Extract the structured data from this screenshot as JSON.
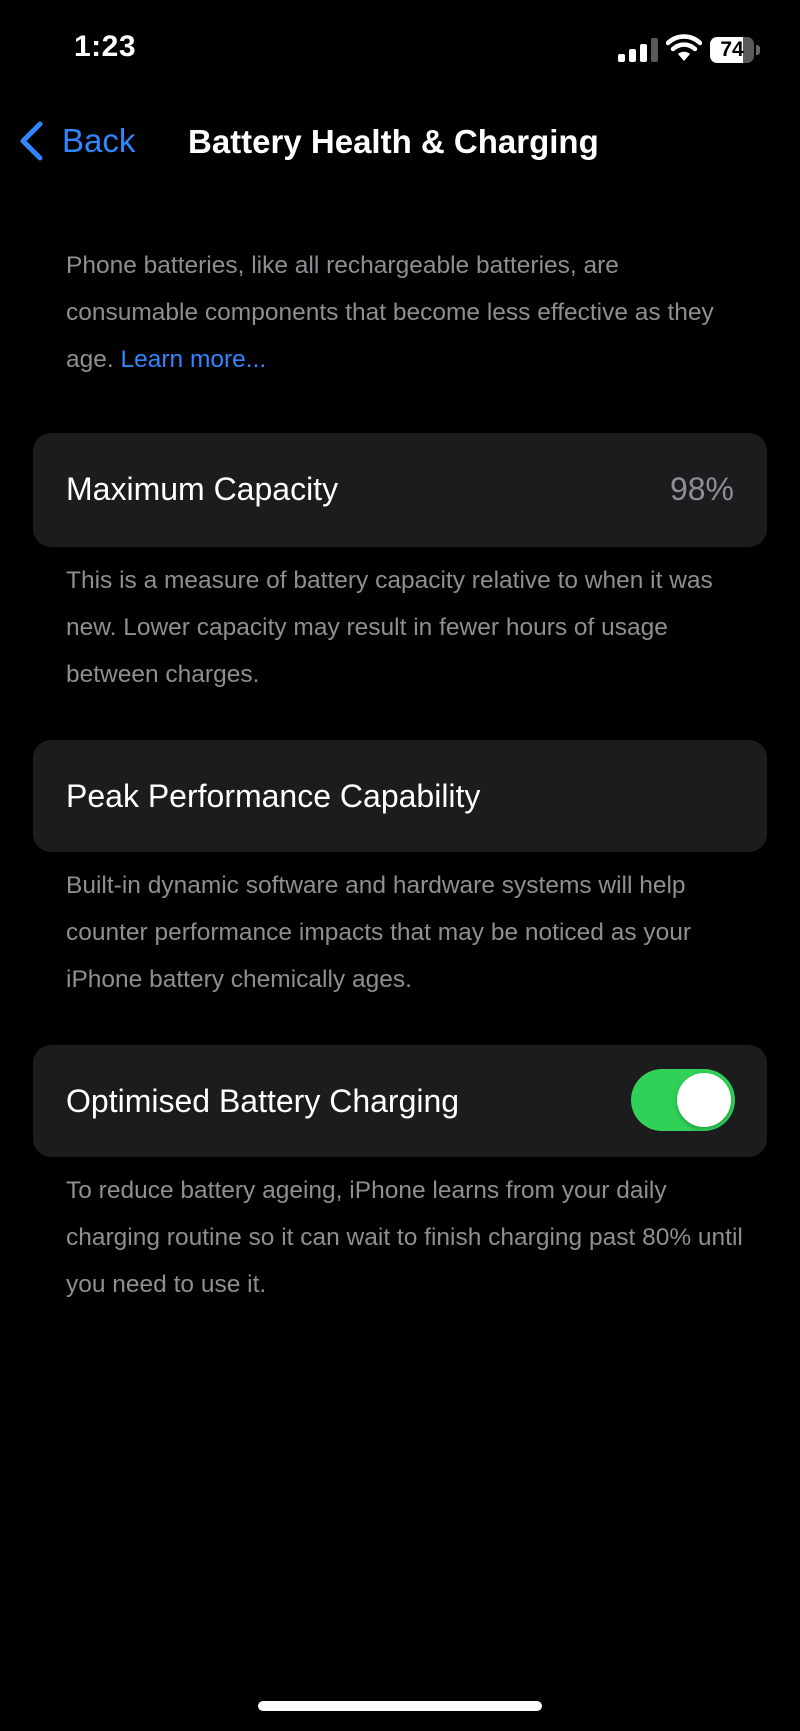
{
  "status_bar": {
    "time": "1:23",
    "battery_percent": "74",
    "battery_level": 0.74,
    "icons": [
      "cellular-signal-icon",
      "wifi-icon",
      "battery-icon"
    ]
  },
  "nav": {
    "back_label": "Back",
    "title": "Battery Health & Charging"
  },
  "intro": {
    "text": "Phone batteries, like all rechargeable batteries, are consumable components that become less effective as they age.",
    "link": "Learn more..."
  },
  "max_capacity": {
    "label": "Maximum Capacity",
    "value": "98%",
    "footnote": "This is a measure of battery capacity relative to when it was new. Lower capacity may result in fewer hours of usage between charges."
  },
  "peak_performance": {
    "label": "Peak Performance Capability",
    "footnote": "Built-in dynamic software and hardware systems will help counter performance impacts that may be noticed as your iPhone battery chemically ages."
  },
  "optimised_charging": {
    "label": "Optimised Battery Charging",
    "enabled": true,
    "footnote": "To reduce battery ageing, iPhone learns from your daily charging routine so it can wait to finish charging past 80% until you need to use it."
  },
  "colors": {
    "accent": "#2f86ff",
    "toggle_on": "#30d158",
    "card_bg": "#1c1c1e",
    "secondary_text": "#8e8e93"
  }
}
